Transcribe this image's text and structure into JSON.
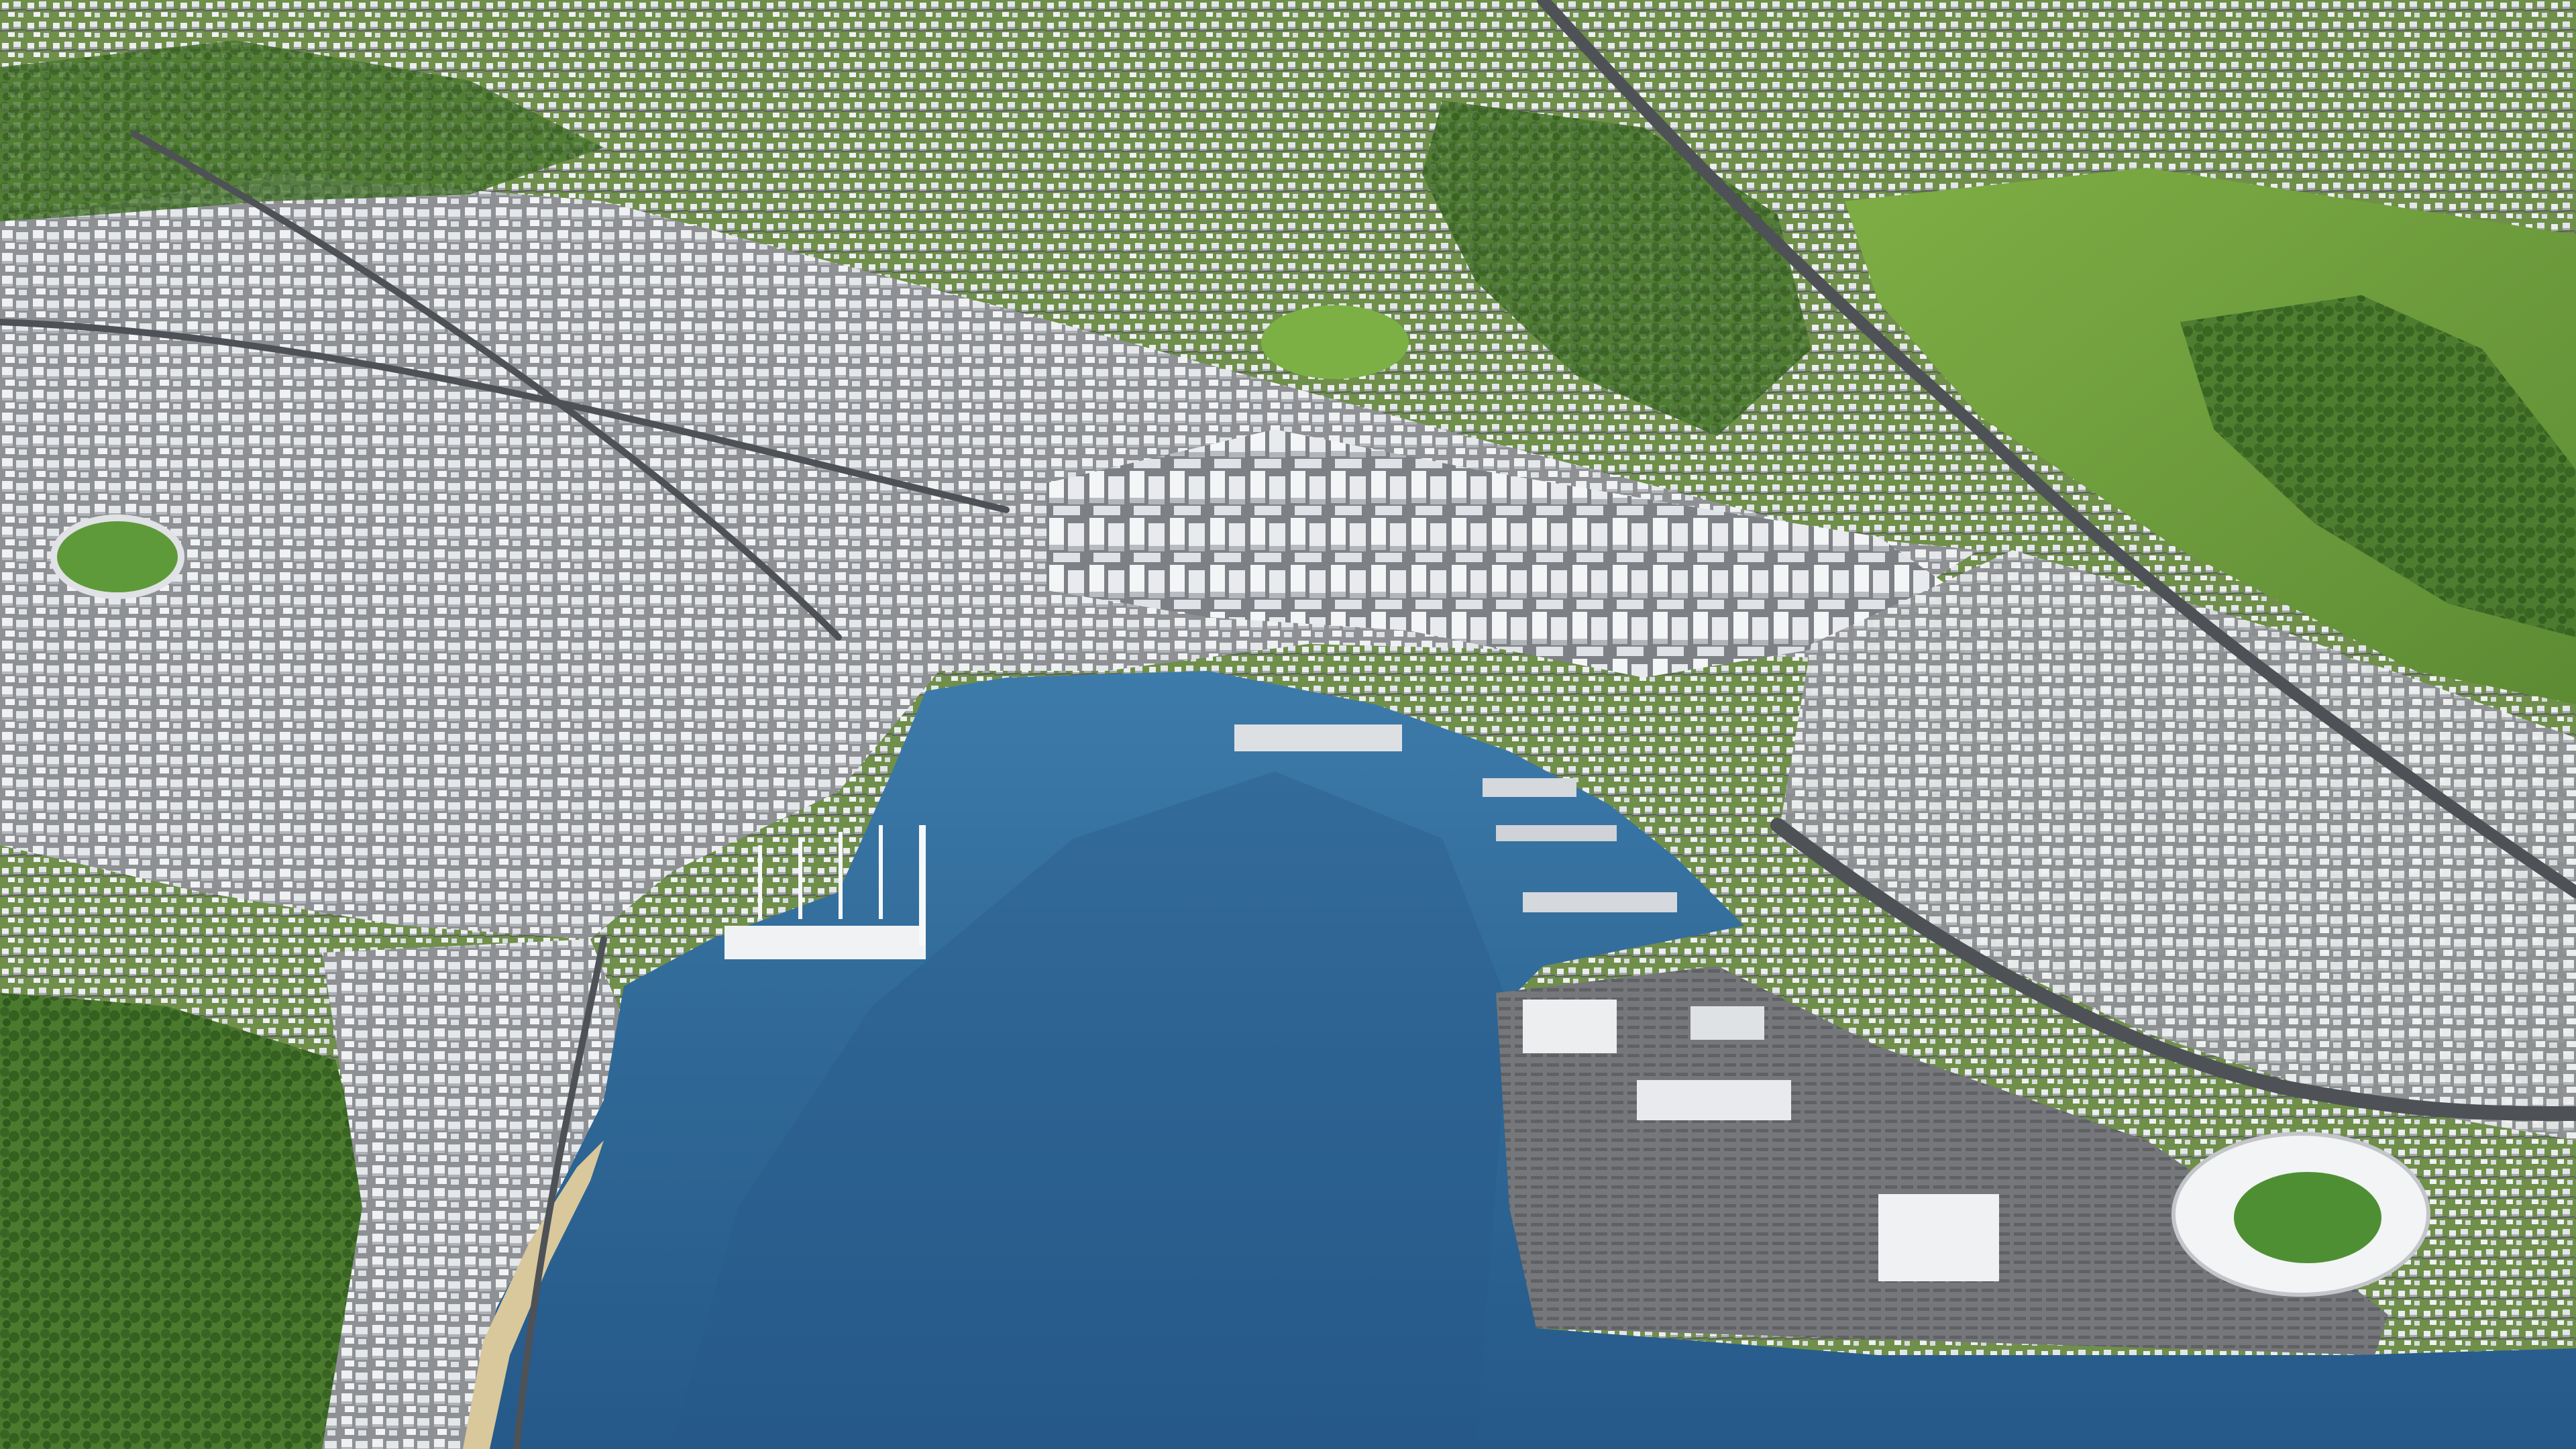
{
  "scene": {
    "kind": "aerial-3d-city-model",
    "palette": {
      "water": "#2f6896",
      "water_deep": "#1f4f7a",
      "water_shallow": "#3d7bab",
      "green_hills": "#6e9c3c",
      "forest": "#3f6a2a",
      "pasture": "#8fbf4a",
      "urban_ground": "#8d8f93",
      "buildings": "#e9ecef",
      "building_shadow": "#a9adb4",
      "roads": "#54575c",
      "port_tarmac": "#7c7e82",
      "beach": "#d9c89c",
      "stadium_pitch": "#4f8f34"
    }
  }
}
